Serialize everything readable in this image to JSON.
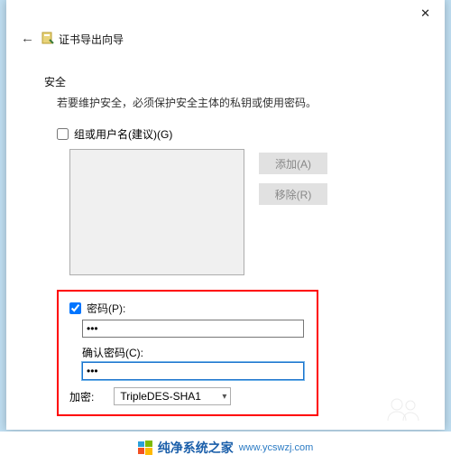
{
  "wizard": {
    "title": "证书导出向导",
    "close_label": "✕",
    "back_label": "←"
  },
  "section": {
    "heading": "安全",
    "description": "若要维护安全，必须保护安全主体的私钥或使用密码。"
  },
  "group": {
    "checkbox_label": "组或用户名(建议)(G)",
    "add_button": "添加(A)",
    "remove_button": "移除(R)"
  },
  "password": {
    "checkbox_label": "密码(P):",
    "value": "•••",
    "confirm_label": "确认密码(C):",
    "confirm_value": "•••"
  },
  "encryption": {
    "label": "加密:",
    "selected": "TripleDES-SHA1"
  },
  "footer": {
    "brand": "纯净系统之家",
    "url": "www.ycswzj.com"
  }
}
